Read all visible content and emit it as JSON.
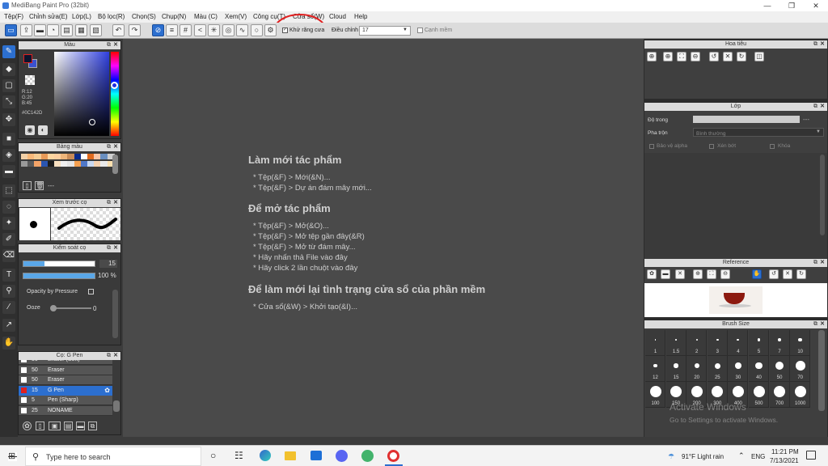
{
  "window": {
    "title": "MediBang Paint Pro (32bit)",
    "min": "—",
    "max": "❐",
    "close": "✕"
  },
  "menu": [
    "Tệp(F)",
    "Chỉnh sửa(E)",
    "Lớp(L)",
    "Bộ lọc(R)",
    "Chọn(S)",
    "Chụp(N)",
    "Màu (C)",
    "Xem(V)",
    "Công cụ(T)",
    "Cửa sổ(W)",
    "Cloud",
    "Help"
  ],
  "toolbar": {
    "antialias": "Khử răng cưa",
    "adjust_label": "Điều chỉnh",
    "adjust_value": "17",
    "edge": "Cạnh mềm"
  },
  "color_panel": {
    "title": "Màu",
    "r": "R:12",
    "g": "G:20",
    "b": "B:45",
    "hex": "#0C142D"
  },
  "swatch_panel": {
    "title": "Bảng màu",
    "extra": "---"
  },
  "brush_preview": {
    "title": "Xem trước cọ"
  },
  "brush_control": {
    "title": "Kiểm soát cọ",
    "size": "15",
    "opacity": "100 %",
    "pressure": "Opacity by Pressure",
    "ooze_label": "Ooze",
    "ooze_value": "0"
  },
  "brush_list": {
    "title": "Cọ: G Pen",
    "items": [
      {
        "size": "50",
        "name": "Eraser (Soft)",
        "color": "#ffffff"
      },
      {
        "size": "50",
        "name": "Eraser",
        "color": "#ffffff"
      },
      {
        "size": "50",
        "name": "Eraser",
        "color": "#ffffff"
      },
      {
        "size": "15",
        "name": "G Pen",
        "color": "#e02020"
      },
      {
        "size": "5",
        "name": "Pen (Sharp)",
        "color": "#ffffff"
      },
      {
        "size": "25",
        "name": "NONAME",
        "color": "#ffffff"
      }
    ]
  },
  "canvas": {
    "h1": "Làm mới tác phẩm",
    "l1": "* Tệp(&F) > Mới(&N)...",
    "l2": "* Tệp(&F) > Dự án đám mây mới...",
    "h2": "Để mở tác phẩm",
    "l3": "* Tệp(&F) > Mở(&O)...",
    "l4": "* Tệp(&F) > Mở tệp gần đây(&R)",
    "l5": "* Tệp(&F) > Mở từ đám mây...",
    "l6": "* Hãy nhấn thả File vào đây",
    "l7": "* Hãy click 2 lần chuột vào đây",
    "h3": "Để làm mới lại tình trạng cửa sổ của phần mềm",
    "l8": "* Cửa sổ(&W) > Khởi tạo(&I)..."
  },
  "navigator": {
    "title": "Hoa tiêu"
  },
  "layer": {
    "title": "Lớp",
    "opacity_label": "Độ trong",
    "opacity_value": "---",
    "blend_label": "Pha trộn",
    "blend_value": "Bình thường",
    "protect": "Bảo vệ alpha",
    "clip": "Xén bớt",
    "lock": "Khóa"
  },
  "reference": {
    "title": "Reference"
  },
  "brush_size": {
    "title": "Brush Size",
    "labels": [
      "1",
      "1.5",
      "2",
      "3",
      "4",
      "5",
      "7",
      "10",
      "12",
      "15",
      "20",
      "25",
      "30",
      "40",
      "50",
      "70",
      "100",
      "150",
      "200",
      "300",
      "400",
      "500",
      "700",
      "1000"
    ]
  },
  "watermark": {
    "line1": "Activate Windows",
    "line2": "Go to Settings to activate Windows."
  },
  "taskbar": {
    "search": "Type here to search",
    "weather": "91°F  Light rain",
    "lang": "ENG",
    "time": "11:21 PM",
    "date": "7/13/2021"
  },
  "swatches": [
    "#f2d0a6",
    "#f7b87a",
    "#f5cc94",
    "#e89a58",
    "#ffd6a0",
    "#ffcf9f",
    "#eeb57a",
    "#c98c58",
    "#0a2a8a",
    "#ffffff",
    "#e06a1e",
    "#f9c7a8",
    "#6a8fc0",
    "#d0d0d0",
    "#9a9a9a",
    "#5a5a5a",
    "#f4a468",
    "#2a55b0",
    "#1c1c1c",
    "#f8e0c0",
    "#f0f0f0",
    "#e5e5e5",
    "#f4a050",
    "#5078c8",
    "#c8d8f0",
    "#f5d2b0",
    "#e9e9e9",
    "#fbe0b0"
  ]
}
